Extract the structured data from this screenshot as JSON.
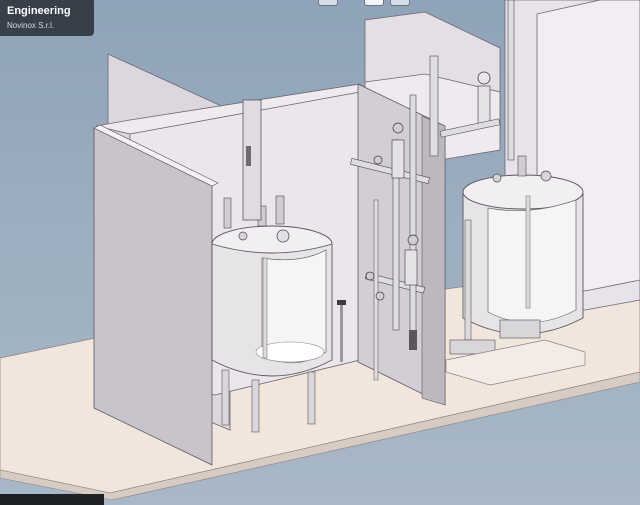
{
  "app": {
    "title": "Engineering",
    "company": "Novinox S.r.l."
  },
  "toolbar": {
    "buttons": [
      {
        "icon": "toolbar-button-1"
      },
      {
        "icon": "toolbar-button-2"
      },
      {
        "icon": "toolbar-button-3"
      }
    ]
  },
  "colors": {
    "sky": "#9caebf",
    "floor": "#f1e6dc",
    "wall_light": "#e9e3ea",
    "wall_shade": "#c9c3cb",
    "tank": "#e6e4e6",
    "pipe": "#dedde0",
    "overlay": "#30363e"
  }
}
